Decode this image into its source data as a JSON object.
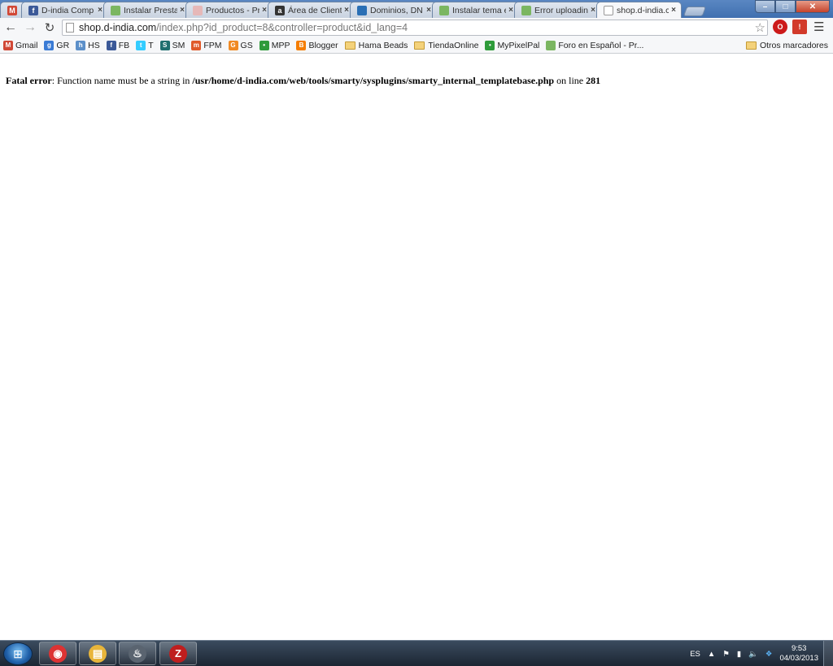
{
  "tabs": [
    {
      "title": "",
      "favicon": "gmail-icon",
      "color": "#d14836",
      "glyph": "M"
    },
    {
      "title": "D-india Comp",
      "favicon": "facebook-icon",
      "color": "#3b5998",
      "glyph": "f"
    },
    {
      "title": "Instalar Presta",
      "favicon": "prestashop-icon",
      "color": "#7bb661",
      "glyph": ""
    },
    {
      "title": "Productos - Pr",
      "favicon": "doc-icon",
      "color": "#e6b8b8",
      "glyph": ""
    },
    {
      "title": "Área de Cliente",
      "favicon": "clientarea-icon",
      "color": "#333333",
      "glyph": "a"
    },
    {
      "title": "Dominios, DN",
      "favicon": "globe-icon",
      "color": "#2a6fb5",
      "glyph": ""
    },
    {
      "title": "Instalar tema e",
      "favicon": "prestashop-icon",
      "color": "#7bb661",
      "glyph": ""
    },
    {
      "title": "Error uploadin",
      "favicon": "prestashop-icon",
      "color": "#7bb661",
      "glyph": ""
    },
    {
      "title": "shop.d-india.c",
      "favicon": "page-icon",
      "color": "#ffffff",
      "glyph": "",
      "active": true
    }
  ],
  "address": {
    "host": "shop.d-india.com",
    "path": "/index.php?id_product=8&controller=product&id_lang=4"
  },
  "bookmarks": [
    {
      "label": "Gmail",
      "icon": "gmail-icon",
      "color": "#d14836",
      "glyph": "M"
    },
    {
      "label": "GR",
      "icon": "google-reader-icon",
      "color": "#3a7bd5",
      "glyph": "g"
    },
    {
      "label": "HS",
      "icon": "hootsuite-icon",
      "color": "#5b8fc9",
      "glyph": "h"
    },
    {
      "label": "FB",
      "icon": "facebook-icon",
      "color": "#3b5998",
      "glyph": "f"
    },
    {
      "label": "T",
      "icon": "twitter-icon",
      "color": "#33ccff",
      "glyph": "t"
    },
    {
      "label": "SM",
      "icon": "sm-icon",
      "color": "#1f6f6f",
      "glyph": "S"
    },
    {
      "label": "FPM",
      "icon": "fpm-icon",
      "color": "#e05a2a",
      "glyph": "m"
    },
    {
      "label": "GS",
      "icon": "gs-icon",
      "color": "#f08a24",
      "glyph": "G"
    },
    {
      "label": "MPP",
      "icon": "mpp-icon",
      "color": "#2e9b3a",
      "glyph": "•"
    },
    {
      "label": "Blogger",
      "icon": "blogger-icon",
      "color": "#f57d00",
      "glyph": "B"
    },
    {
      "label": "Hama Beads",
      "icon": "folder-icon",
      "folder": true
    },
    {
      "label": "TiendaOnline",
      "icon": "folder-icon",
      "folder": true
    },
    {
      "label": "MyPixelPal",
      "icon": "mypixelpal-icon",
      "color": "#2e9b3a",
      "glyph": "•"
    },
    {
      "label": "Foro en Español - Pr...",
      "icon": "prestashop-icon",
      "color": "#7bb661",
      "glyph": ""
    }
  ],
  "other_bookmarks": "Otros marcadores",
  "error": {
    "label": "Fatal error",
    "message": ": Function name must be a string in ",
    "file": "/usr/home/d-india.com/web/tools/smarty/sysplugins/smarty_internal_templatebase.php",
    "online": " on line ",
    "line": "281"
  },
  "taskbar": {
    "items": [
      {
        "name": "chrome-icon",
        "color": "#d33",
        "glyph": "◉"
      },
      {
        "name": "explorer-icon",
        "color": "#e8b53a",
        "glyph": "▤"
      },
      {
        "name": "steam-icon",
        "color": "#5a6470",
        "glyph": "♨"
      },
      {
        "name": "filezilla-icon",
        "color": "#bf1e1e",
        "glyph": "Z"
      }
    ],
    "lang": "ES",
    "time": "9:53",
    "date": "04/03/2013"
  }
}
